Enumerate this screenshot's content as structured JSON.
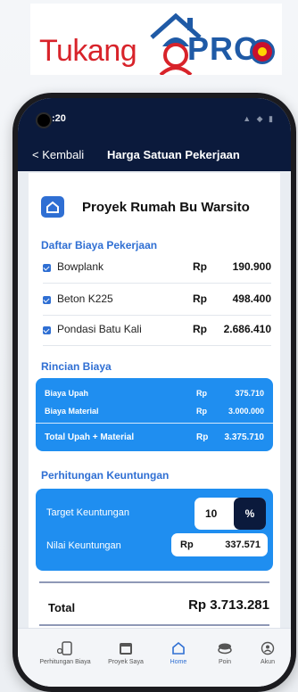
{
  "logo": {
    "part1": "Tukang",
    "part2": "PRO"
  },
  "status": {
    "time": ":20",
    "icons": "▲ ◆ ▮"
  },
  "nav": {
    "back_label": "< Kembali",
    "title": "Harga Satuan Pekerjaan"
  },
  "project": {
    "title": "Proyek Rumah Bu Warsito",
    "icon": "home-icon"
  },
  "daftar": {
    "title": "Daftar Biaya Pekerjaan",
    "items": [
      {
        "name": "Bowplank",
        "currency": "Rp",
        "value": "190.900",
        "checked": true
      },
      {
        "name": "Beton K225",
        "currency": "Rp",
        "value": "498.400",
        "checked": true
      },
      {
        "name": "Pondasi Batu Kali",
        "currency": "Rp",
        "value": "2.686.410",
        "checked": true
      }
    ]
  },
  "rincian": {
    "title": "Rincian Biaya",
    "rows": [
      {
        "label": "Biaya Upah",
        "currency": "Rp",
        "value": "375.710"
      },
      {
        "label": "Biaya Material",
        "currency": "Rp",
        "value": "3.000.000"
      }
    ],
    "total": {
      "label": "Total Upah + Material",
      "currency": "Rp",
      "value": "3.375.710"
    }
  },
  "keuntungan": {
    "title": "Perhitungan  Keuntungan",
    "target_label": "Target Keuntungan",
    "target_value": "10",
    "target_unit": "%",
    "nilai_label": "Nilai Keuntungan",
    "nilai_currency": "Rp",
    "nilai_value": "337.571"
  },
  "total": {
    "label": "Total",
    "value": "Rp 3.713.281"
  },
  "bottom_nav": [
    {
      "label": "Perhitungan Biaya",
      "icon": "calculator-icon",
      "active": false
    },
    {
      "label": "Proyek Saya",
      "icon": "calendar-icon",
      "active": false
    },
    {
      "label": "Home",
      "icon": "home-icon",
      "active": true
    },
    {
      "label": "Poin",
      "icon": "coins-icon",
      "active": false
    },
    {
      "label": "Akun",
      "icon": "user-icon",
      "active": false
    }
  ],
  "colors": {
    "navy": "#0b1a3c",
    "accent": "#2f6fd3",
    "card": "#1f8ef0",
    "brand_red": "#d8232a",
    "brand_blue": "#1f5aa6"
  }
}
